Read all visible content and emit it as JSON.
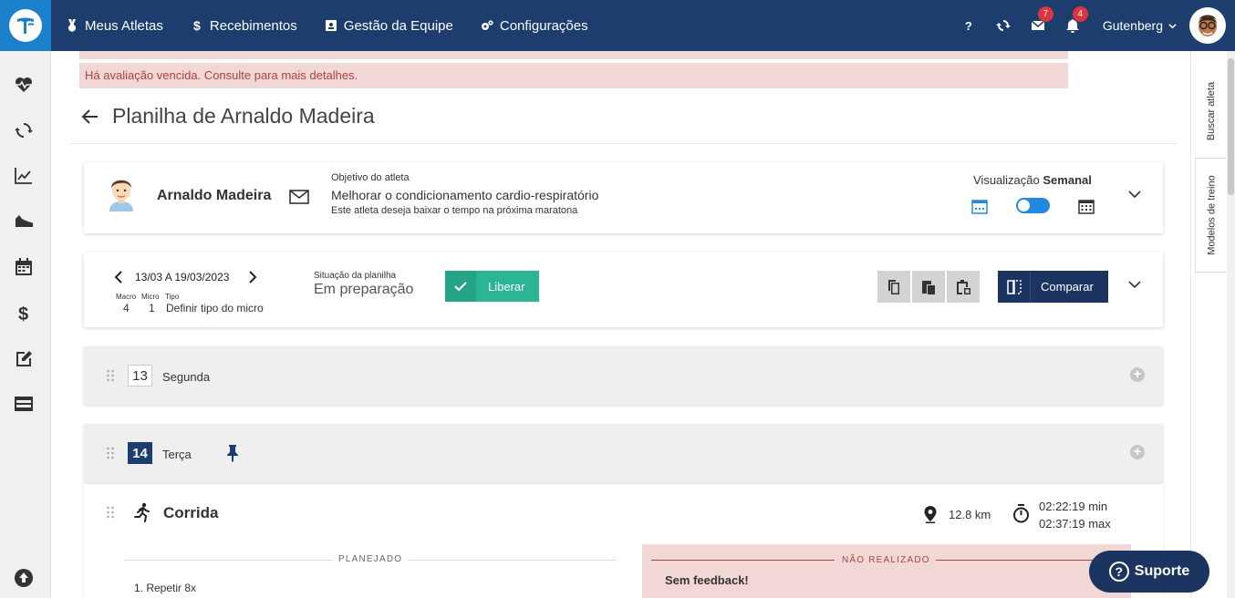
{
  "nav": {
    "items": [
      {
        "label": "Meus Atletas",
        "icon": "medal-icon"
      },
      {
        "label": "Recebimentos",
        "icon": "dollar-icon"
      },
      {
        "label": "Gestão da Equipe",
        "icon": "id-card-icon"
      },
      {
        "label": "Configurações",
        "icon": "gears-icon"
      }
    ],
    "help_label": "?",
    "messages_badge": "7",
    "notifications_badge": "4",
    "user_name": "Gutenberg"
  },
  "sidebar": {
    "icons": [
      "heartbeat-icon",
      "sync-icon",
      "chart-line-icon",
      "running-shoe-icon",
      "calendar-icon",
      "dollar-icon",
      "edit-icon",
      "film-icon",
      "upload-icon"
    ]
  },
  "rail": {
    "tab1": "Buscar atleta",
    "tab2": "Modelos de treino"
  },
  "alert": {
    "text": "Há avaliação vencida. Consulte para mais detalhes."
  },
  "page": {
    "title": "Planilha de Arnaldo Madeira"
  },
  "athlete": {
    "name": "Arnaldo Madeira",
    "goal_label": "Objetivo do atleta",
    "goal": "Melhorar o condicionamento cardio-respiratório",
    "goal_detail": "Este atleta deseja baixar o tempo na próxima maratona",
    "viz_label": "Visualização",
    "viz_mode": "Semanal"
  },
  "week": {
    "range": "13/03 A 19/03/2023",
    "macro_label": "Macro",
    "macro_value": "4",
    "micro_label": "Micro",
    "micro_value": "1",
    "tipo_label": "Tipo",
    "tipo_value": "Definir tipo do micro",
    "situation_label": "Situação da planilha",
    "situation_value": "Em preparação",
    "release_label": "Liberar",
    "compare_label": "Comparar"
  },
  "days": [
    {
      "number": "13",
      "name": "Segunda",
      "active": false
    },
    {
      "number": "14",
      "name": "Terça",
      "active": true
    }
  ],
  "workout": {
    "type": "Corrida",
    "distance": "12.8 km",
    "time_min": "02:22:19 min",
    "time_max": "02:37:19 max",
    "planned_label": "PLANEJADO",
    "step1": "1. Repetir 8x",
    "status_label": "NÃO REALIZADO",
    "feedback": "Sem feedback!"
  },
  "support": {
    "label": "Suporte"
  },
  "colors": {
    "topbar": "#1c3d6e",
    "logo": "#1b7fc9",
    "alert_bg": "#f2d7d7",
    "alert_text": "#a94442",
    "release_green": "#2bb596",
    "compare_navy": "#1c3560",
    "toggle_blue": "#2389e0",
    "badge_red": "#d9363e"
  }
}
